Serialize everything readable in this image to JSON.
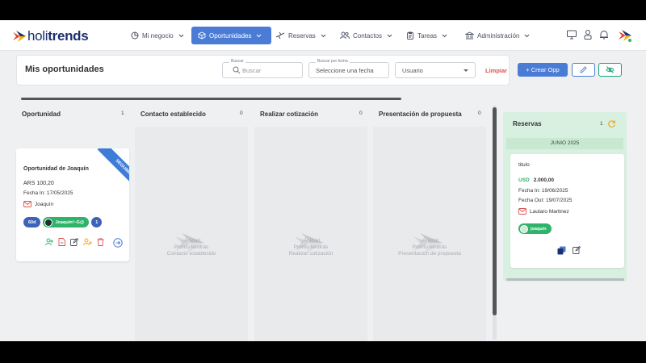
{
  "brand": {
    "name_light": "holi",
    "name_bold": "trends"
  },
  "nav": {
    "items": [
      {
        "label": "Mi negocio",
        "icon": "chart-pie-icon"
      },
      {
        "label": "Oportunidades",
        "icon": "box-icon",
        "active": true
      },
      {
        "label": "Reservas",
        "icon": "plane-icon"
      },
      {
        "label": "Contactos",
        "icon": "users-icon"
      },
      {
        "label": "Tareas",
        "icon": "clipboard-icon"
      },
      {
        "label": "Administración",
        "icon": "bank-icon"
      }
    ]
  },
  "header": {
    "title": "Mis oportunidades",
    "search": {
      "label": "Buscar",
      "placeholder": "Buscar"
    },
    "date_filter": {
      "label": "Buscar por fecha",
      "value": "Seleccione una fecha"
    },
    "user_select": {
      "value": "Usuario"
    },
    "clear_label": "Limpiar",
    "create_label": "+ Crear Opp"
  },
  "columns": [
    {
      "name": "Oportunidad",
      "count": "1"
    },
    {
      "name": "Contacto establecido",
      "count": "0",
      "empty": {
        "cheer": "¡Ánimo!",
        "soon": "Pronto tendrás",
        "stage": "Contacto establecido"
      }
    },
    {
      "name": "Realizar cotización",
      "count": "0",
      "empty": {
        "cheer": "¡Ánimo!",
        "soon": "Pronto tendrás",
        "stage": "Realizar cotización"
      }
    },
    {
      "name": "Presentación de propuesta",
      "count": "0",
      "empty": {
        "cheer": "¡Ánimo!",
        "soon": "Pronto tendrás",
        "stage": "Presentación de propuesta"
      }
    }
  ],
  "opportunity": {
    "ribbon": "SEGUIMIENTO",
    "title": "Oportunidad de Joaquín",
    "amount": "ARS 100,20",
    "date": "Fecha In: 17/05/2025",
    "person": "Joaquín",
    "days_chip": "60d",
    "user_chip": "Joaquín!~G@",
    "count_chip": "1"
  },
  "reservations": {
    "title": "Reservas",
    "count": "1",
    "month": "JUNIO 2025",
    "card": {
      "title": "titulo",
      "currency": "USD",
      "amount": "2.000,00",
      "date_in": "Fecha In: 19/06/2025",
      "date_out": "Fecha Out: 19/07/2025",
      "person": "Lautaro Martinez",
      "chip": "joaquin"
    }
  },
  "colors": {
    "primary": "#4a7cd6",
    "success": "#2fb36a",
    "danger": "#d9534f",
    "navy": "#1d2f6f"
  }
}
